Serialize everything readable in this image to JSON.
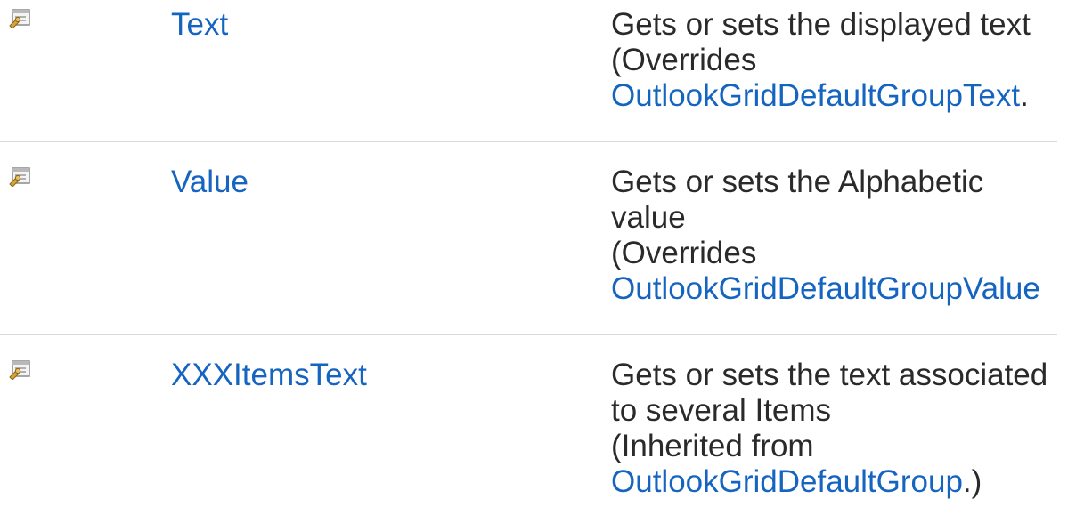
{
  "rows": [
    {
      "icon": "property-icon",
      "name": "Text",
      "summary": "Gets or sets the displayed text",
      "note_prefix": "(Overrides",
      "link_text": "OutlookGridDefaultGroupText",
      "link_suffix": "."
    },
    {
      "icon": "property-icon",
      "name": "Value",
      "summary_line1": "Gets or sets the Alphabetic",
      "summary_line2": "value",
      "note_prefix": "(Overrides",
      "link_text": "OutlookGridDefaultGroupValue"
    },
    {
      "icon": "property-icon",
      "name": "XXXItemsText",
      "summary_line1": "Gets or sets the text associated",
      "summary_line2": "to several Items",
      "note_prefix": "(Inherited from",
      "link_text": "OutlookGridDefaultGroup",
      "link_suffix": ".)"
    }
  ]
}
